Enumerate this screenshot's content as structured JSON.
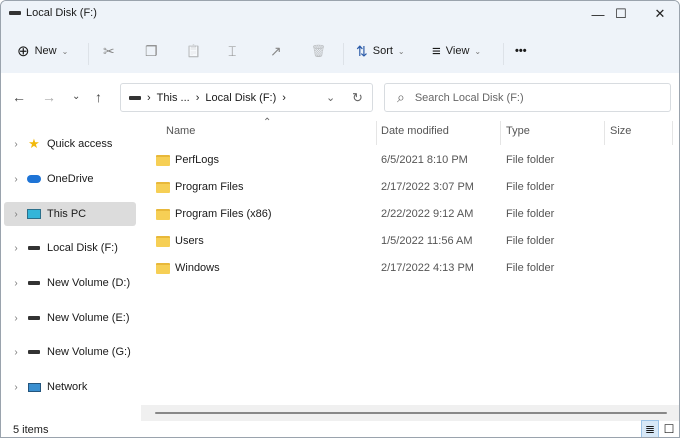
{
  "window": {
    "title": "Local Disk (F:)",
    "minimize": "—",
    "maximize": "☐",
    "close": "✕"
  },
  "toolbar": {
    "new": "New",
    "sort": "Sort",
    "view": "View",
    "more": "•••",
    "new_icon": "⊕",
    "cut_icon": "✂",
    "copy_icon": "❐",
    "paste_icon": "📋",
    "rename_icon": "⌶",
    "share_icon": "↗",
    "delete_icon": "🗑",
    "sort_icon": "⇅",
    "view_icon": "≡"
  },
  "nav": {
    "back": "←",
    "forward": "→",
    "recent": "⌄",
    "up": "↑"
  },
  "address": {
    "segments": [
      "This ...",
      "Local Disk (F:)"
    ],
    "sep": "›",
    "dropdown": "⌄",
    "refresh": "↻"
  },
  "search": {
    "placeholder": "Search Local Disk (F:)",
    "icon": "⌕"
  },
  "sidebar": {
    "items": [
      {
        "label": "Quick access",
        "icon": "star-icon"
      },
      {
        "label": "OneDrive",
        "icon": "cloud-icon"
      },
      {
        "label": "This PC",
        "icon": "monitor-icon",
        "selected": true
      },
      {
        "label": "Local Disk (F:)",
        "icon": "drive-icon"
      },
      {
        "label": "New Volume (D:)",
        "icon": "drive-icon"
      },
      {
        "label": "New Volume (E:)",
        "icon": "drive-icon"
      },
      {
        "label": "New Volume (G:)",
        "icon": "drive-icon"
      },
      {
        "label": "Network",
        "icon": "network-icon"
      }
    ],
    "expand": "›"
  },
  "columns": {
    "name": "Name",
    "date": "Date modified",
    "type": "Type",
    "size": "Size",
    "sort_indicator": "⌃"
  },
  "files": [
    {
      "name": "PerfLogs",
      "date": "6/5/2021 8:10 PM",
      "type": "File folder"
    },
    {
      "name": "Program Files",
      "date": "2/17/2022 3:07 PM",
      "type": "File folder"
    },
    {
      "name": "Program Files (x86)",
      "date": "2/22/2022 9:12 AM",
      "type": "File folder"
    },
    {
      "name": "Users",
      "date": "1/5/2022 11:56 AM",
      "type": "File folder"
    },
    {
      "name": "Windows",
      "date": "2/17/2022 4:13 PM",
      "type": "File folder"
    }
  ],
  "status": {
    "count": "5 items",
    "details_icon": "≣",
    "tiles_icon": "☐"
  }
}
